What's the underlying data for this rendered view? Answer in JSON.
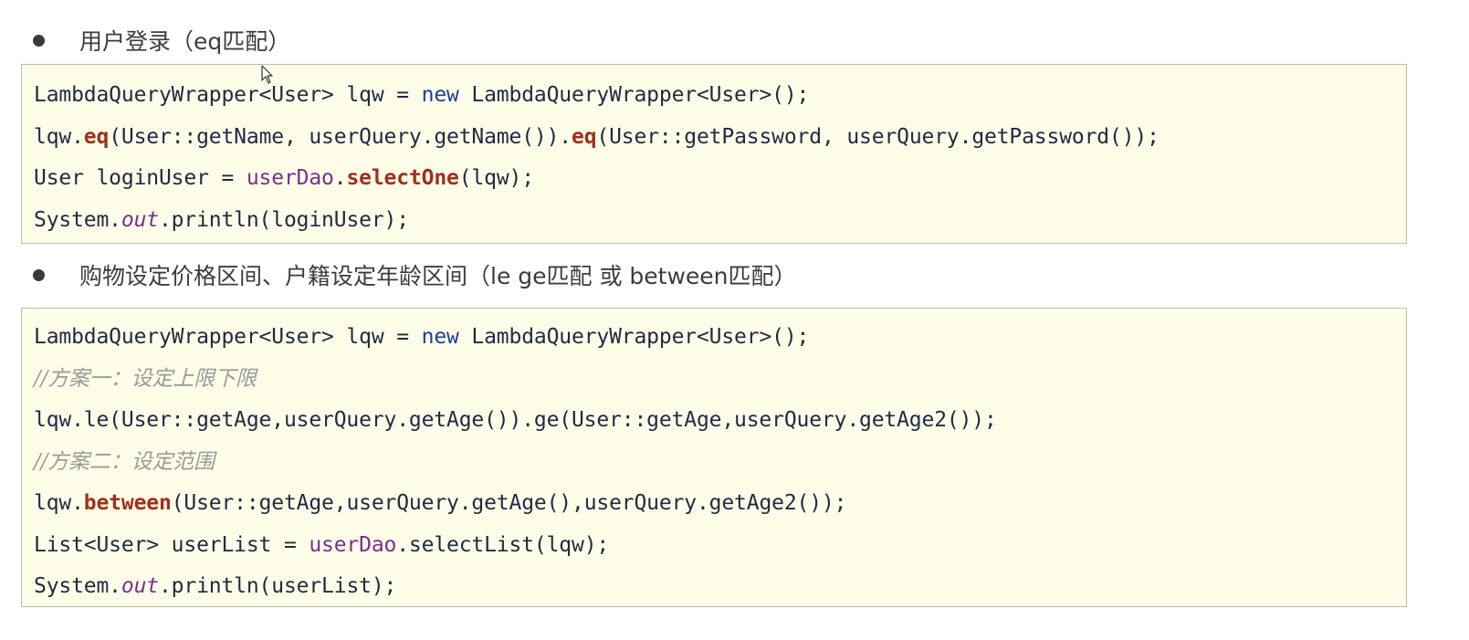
{
  "sections": [
    {
      "heading": "用户登录（eq匹配）",
      "code_lines": [
        [
          {
            "t": "LambdaQueryWrapper<User> lqw = ",
            "k": "plain"
          },
          {
            "t": "new",
            "k": "kw"
          },
          {
            "t": " LambdaQueryWrapper<User>();",
            "k": "plain"
          }
        ],
        [
          {
            "t": "lqw.",
            "k": "plain"
          },
          {
            "t": "eq",
            "k": "method"
          },
          {
            "t": "(User::getName, userQuery.getName()).",
            "k": "plain"
          },
          {
            "t": "eq",
            "k": "method"
          },
          {
            "t": "(User::getPassword, userQuery.getPassword());",
            "k": "plain"
          }
        ],
        [
          {
            "t": "User loginUser = ",
            "k": "plain"
          },
          {
            "t": "userDao",
            "k": "field"
          },
          {
            "t": ".",
            "k": "plain"
          },
          {
            "t": "selectOne",
            "k": "method"
          },
          {
            "t": "(lqw);",
            "k": "plain"
          }
        ],
        [
          {
            "t": "System.",
            "k": "plain"
          },
          {
            "t": "out",
            "k": "static"
          },
          {
            "t": ".println(loginUser);",
            "k": "plain"
          }
        ]
      ]
    },
    {
      "heading": "购物设定价格区间、户籍设定年龄区间（le ge匹配  或  between匹配）",
      "code_lines": [
        [
          {
            "t": "LambdaQueryWrapper<User> lqw = ",
            "k": "plain"
          },
          {
            "t": "new",
            "k": "kw"
          },
          {
            "t": " LambdaQueryWrapper<User>();",
            "k": "plain"
          }
        ],
        [
          {
            "t": "//方案一：设定上限下限",
            "k": "comment"
          }
        ],
        [
          {
            "t": "lqw.le(User::getAge,userQuery.getAge()).ge(User::getAge,userQuery.getAge2());",
            "k": "plain"
          }
        ],
        [
          {
            "t": "//方案二：设定范围",
            "k": "comment"
          }
        ],
        [
          {
            "t": "lqw.",
            "k": "plain"
          },
          {
            "t": "between",
            "k": "method"
          },
          {
            "t": "(User::getAge,userQuery.getAge(),userQuery.getAge2());",
            "k": "plain"
          }
        ],
        [
          {
            "t": "List<User> userList = ",
            "k": "plain"
          },
          {
            "t": "userDao",
            "k": "field"
          },
          {
            "t": ".selectList(lqw);",
            "k": "plain"
          }
        ],
        [
          {
            "t": "System.",
            "k": "plain"
          },
          {
            "t": "out",
            "k": "static"
          },
          {
            "t": ".println(userList);",
            "k": "plain"
          }
        ]
      ]
    }
  ],
  "cursor_icon": "mouse-pointer-icon"
}
